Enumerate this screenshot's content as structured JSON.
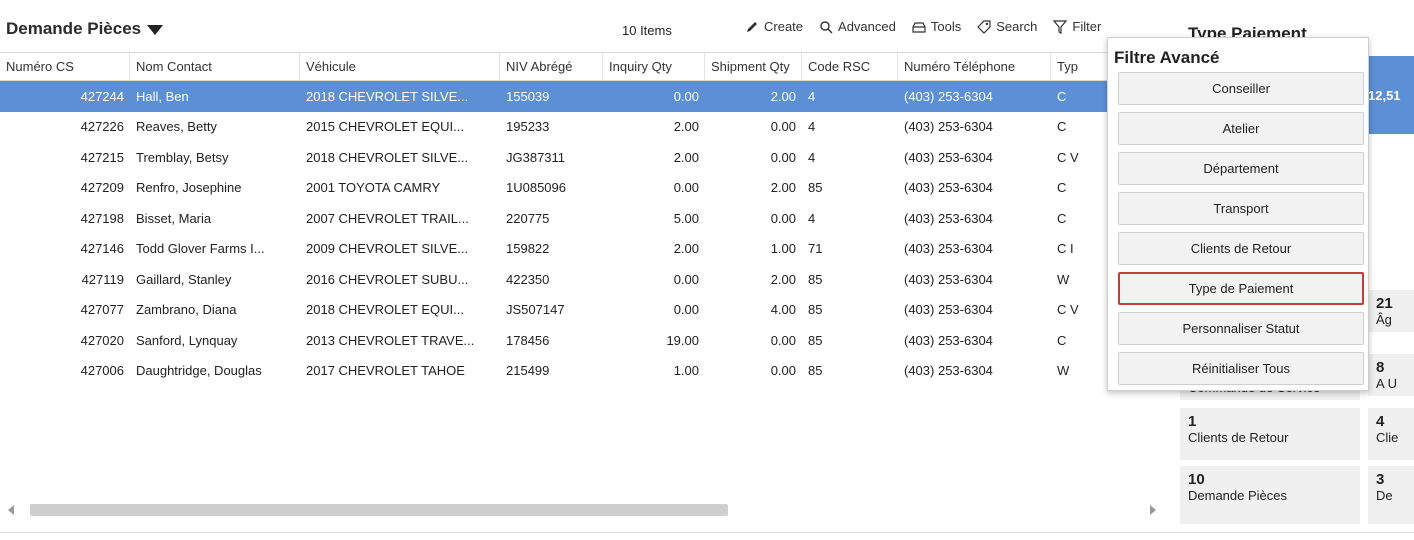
{
  "header": {
    "title": "Demande Pièces",
    "item_count": "10 Items",
    "toolbar": {
      "create": "Create",
      "advanced": "Advanced",
      "tools": "Tools",
      "search": "Search",
      "filter": "Filter"
    }
  },
  "grid": {
    "columns": [
      "Numéro CS",
      "Nom Contact",
      "Véhicule",
      "NIV Abrégé",
      "Inquiry Qty",
      "Shipment Qty",
      "Code RSC",
      "Numéro Téléphone",
      "Typ"
    ],
    "rows": [
      {
        "cs": "427244",
        "contact": "Hall, Ben",
        "vehicle": "2018 CHEVROLET SILVE...",
        "niv": "155039",
        "inquiry": "0.00",
        "shipment": "2.00",
        "rsc": "4",
        "phone": "(403) 253-6304",
        "type": "C"
      },
      {
        "cs": "427226",
        "contact": "Reaves, Betty",
        "vehicle": "2015 CHEVROLET EQUI...",
        "niv": "195233",
        "inquiry": "2.00",
        "shipment": "0.00",
        "rsc": "4",
        "phone": "(403) 253-6304",
        "type": "C"
      },
      {
        "cs": "427215",
        "contact": "Tremblay, Betsy",
        "vehicle": "2018 CHEVROLET SILVE...",
        "niv": "JG387311",
        "inquiry": "2.00",
        "shipment": "0.00",
        "rsc": "4",
        "phone": "(403) 253-6304",
        "type": "C V"
      },
      {
        "cs": "427209",
        "contact": "Renfro, Josephine",
        "vehicle": "2001 TOYOTA CAMRY",
        "niv": "1U085096",
        "inquiry": "0.00",
        "shipment": "2.00",
        "rsc": "85",
        "phone": "(403) 253-6304",
        "type": "C"
      },
      {
        "cs": "427198",
        "contact": "Bisset, Maria",
        "vehicle": "2007 CHEVROLET TRAIL...",
        "niv": "220775",
        "inquiry": "5.00",
        "shipment": "0.00",
        "rsc": "4",
        "phone": "(403) 253-6304",
        "type": "C"
      },
      {
        "cs": "427146",
        "contact": "Todd Glover Farms I...",
        "vehicle": "2009 CHEVROLET SILVE...",
        "niv": "159822",
        "inquiry": "2.00",
        "shipment": "1.00",
        "rsc": "71",
        "phone": "(403) 253-6304",
        "type": "C I"
      },
      {
        "cs": "427119",
        "contact": "Gaillard, Stanley",
        "vehicle": "2016 CHEVROLET SUBU...",
        "niv": "422350",
        "inquiry": "0.00",
        "shipment": "2.00",
        "rsc": "85",
        "phone": "(403) 253-6304",
        "type": "W"
      },
      {
        "cs": "427077",
        "contact": "Zambrano, Diana",
        "vehicle": "2018 CHEVROLET EQUI...",
        "niv": "JS507147",
        "inquiry": "0.00",
        "shipment": "4.00",
        "rsc": "85",
        "phone": "(403) 253-6304",
        "type": "C V"
      },
      {
        "cs": "427020",
        "contact": "Sanford, Lynquay",
        "vehicle": "2013 CHEVROLET TRAVE...",
        "niv": "178456",
        "inquiry": "19.00",
        "shipment": "0.00",
        "rsc": "85",
        "phone": "(403) 253-6304",
        "type": "C"
      },
      {
        "cs": "427006",
        "contact": "Daughtridge, Douglas",
        "vehicle": "2017 CHEVROLET TAHOE",
        "niv": "215499",
        "inquiry": "1.00",
        "shipment": "0.00",
        "rsc": "85",
        "phone": "(403) 253-6304",
        "type": "W"
      }
    ]
  },
  "side_panel": {
    "title": "Type Paiement",
    "bar_value": "12,51",
    "tiles": [
      {
        "value": "21",
        "label": "Âg"
      },
      {
        "value": "8",
        "label": "A U"
      },
      {
        "value": "",
        "label": "Commande de Service"
      },
      {
        "value": "1",
        "label": "Clients de Retour"
      },
      {
        "value": "4",
        "label": "Clie"
      },
      {
        "value": "10",
        "label": "Demande Pièces"
      },
      {
        "value": "3",
        "label": "De"
      }
    ]
  },
  "filter_popover": {
    "title": "Filtre Avancé",
    "buttons": [
      "Conseiller",
      "Atelier",
      "Département",
      "Transport",
      "Clients de Retour",
      "Type de Paiement",
      "Personnaliser Statut",
      "Réinitialiser Tous"
    ],
    "highlighted": "Type de Paiement"
  },
  "colors": {
    "selected_row": "#5b8fd6",
    "highlight_border": "#c63b3b",
    "button_bg": "#f2f2f2"
  }
}
